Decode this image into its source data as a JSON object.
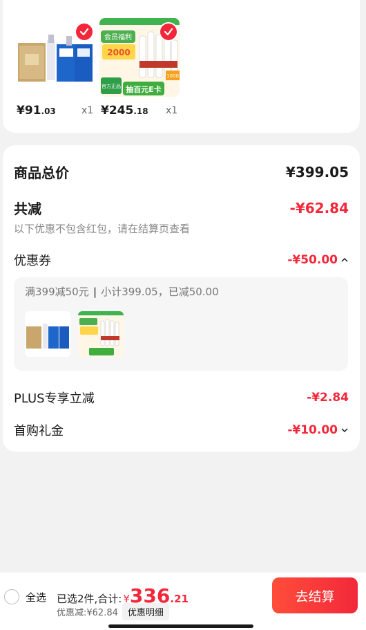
{
  "products": [
    {
      "price_symbol": "¥",
      "price_int": "91",
      "price_dec": ".03",
      "qty": "x1"
    },
    {
      "price_symbol": "¥",
      "price_int": "245",
      "price_dec": ".18",
      "qty": "x1"
    }
  ],
  "product2_banner": {
    "tag1": "会员福利",
    "tag2": "2000",
    "tag3": "官方正品",
    "tag4": "抽百元E卡",
    "tag5": "1000"
  },
  "summary": {
    "total_label": "商品总价",
    "total_value": "¥399.05",
    "reduce_label": "共减",
    "reduce_value": "-¥62.84",
    "note": "以下优惠不包含红包，请在结算页查看",
    "coupon_label": "优惠券",
    "coupon_value": "-¥50.00",
    "coupon_detail_a": "满399减50元",
    "coupon_detail_sep": "|",
    "coupon_detail_b": "小计399.05，已减50.00",
    "plus_label": "PLUS专享立减",
    "plus_value": "-¥2.84",
    "first_label": "首购礼金",
    "first_value": "-¥10.00"
  },
  "bottom": {
    "select_all": "全选",
    "selected_text": "已选2件,合计:",
    "total_symbol": "¥",
    "total_int": "336",
    "total_dec": ".21",
    "discount": "优惠减:¥62.84",
    "detail_button": "优惠明细",
    "checkout_button": "去结算"
  },
  "colors": {
    "accent": "#f2283a",
    "background": "#f2f2f2"
  }
}
